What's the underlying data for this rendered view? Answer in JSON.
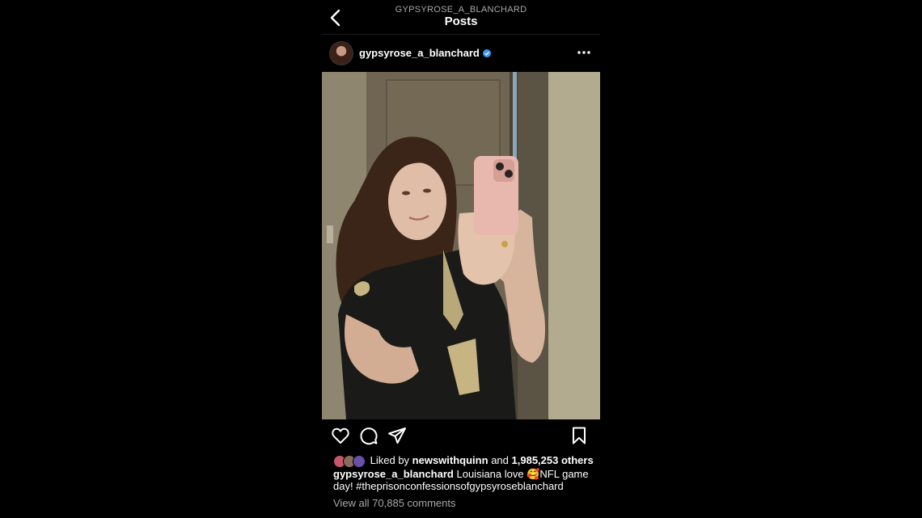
{
  "header": {
    "account_name": "GYPSYROSE_A_BLANCHARD",
    "title": "Posts"
  },
  "post": {
    "username": "gypsyrose_a_blanchard",
    "verified": true,
    "likes": {
      "prefix": "Liked by",
      "liked_by_user": "newswithquinn",
      "conjunction": "and",
      "others": "1,985,253 others"
    },
    "caption": {
      "username": "gypsyrose_a_blanchard",
      "text": "Louisiana love 🥰NFL game day! #theprisonconfessionsofgypsyroseblanchard"
    },
    "view_comments": "View all 70,885 comments"
  },
  "icons": [
    "back-icon",
    "verified-icon",
    "more-icon",
    "heart-icon",
    "comment-icon",
    "share-icon",
    "bookmark-icon"
  ],
  "colors": {
    "background": "#000000",
    "verified": "#3897f0",
    "secondary_text": "#a8a8a8"
  }
}
